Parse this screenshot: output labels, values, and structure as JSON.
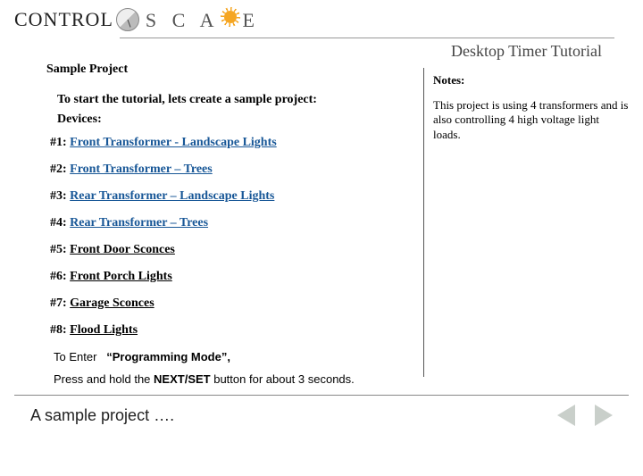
{
  "header": {
    "brand_left": "CONTROL",
    "brand_right": "S C A   E",
    "doc_title": "Desktop Timer Tutorial"
  },
  "main": {
    "slide_title": "Sample Project",
    "intro": "To start the tutorial, lets create a sample project:",
    "devices_header": "Devices:",
    "devices": [
      {
        "num": "#1:",
        "name": "Front Transformer - Landscape Lights",
        "link": true
      },
      {
        "num": "#2:",
        "name": "Front Transformer – Trees",
        "link": true
      },
      {
        "num": "#3:",
        "name": "Rear Transformer – Landscape Lights",
        "link": true
      },
      {
        "num": "#4:",
        "name": "Rear Transformer – Trees",
        "link": true
      },
      {
        "num": "#5:",
        "name": "Front Door Sconces",
        "link": false
      },
      {
        "num": "#6:",
        "name": "Front Porch Lights",
        "link": false
      },
      {
        "num": "#7:",
        "name": "Garage Sconces",
        "link": false
      },
      {
        "num": "#8:",
        "name": "Flood Lights",
        "link": false
      }
    ],
    "programming": {
      "prefix": "To Enter",
      "mode_bold": "“Programming Mode”,",
      "instruction_pre": "Press and hold the ",
      "instruction_bold": "NEXT/SET",
      "instruction_post": " button for about 3 seconds."
    }
  },
  "notes": {
    "header": "Notes:",
    "body": "This project is using 4 transformers and is also controlling 4 high voltage light loads."
  },
  "footer": {
    "text": "A sample project …."
  }
}
